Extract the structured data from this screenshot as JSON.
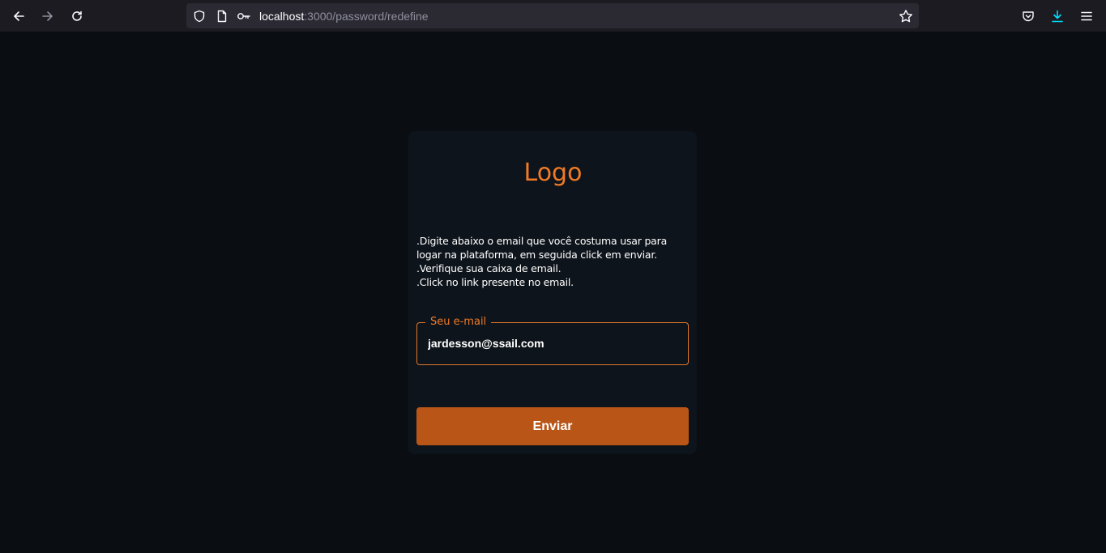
{
  "browser": {
    "url_host": "localhost",
    "url_path": ":3000/password/redefine",
    "icons": [
      "back-icon",
      "forward-icon",
      "reload-icon",
      "shield-icon",
      "page-icon",
      "key-icon",
      "star-icon",
      "pocket-icon",
      "download-icon",
      "menu-icon"
    ]
  },
  "page": {
    "logo": "Logo",
    "instructions": [
      ".Digite abaixo o email que você costuma usar para logar na plataforma, em seguida click em enviar.",
      ".Verifique sua caixa de email.",
      ".Click no link presente no email."
    ],
    "email_label": "Seu e-mail",
    "email_value": "jardesson@ssail.com",
    "submit_label": "Enviar"
  },
  "colors": {
    "background": "#0a0d12",
    "card": "#0e141b",
    "accent": "#f07a27",
    "button": "#b95517"
  }
}
